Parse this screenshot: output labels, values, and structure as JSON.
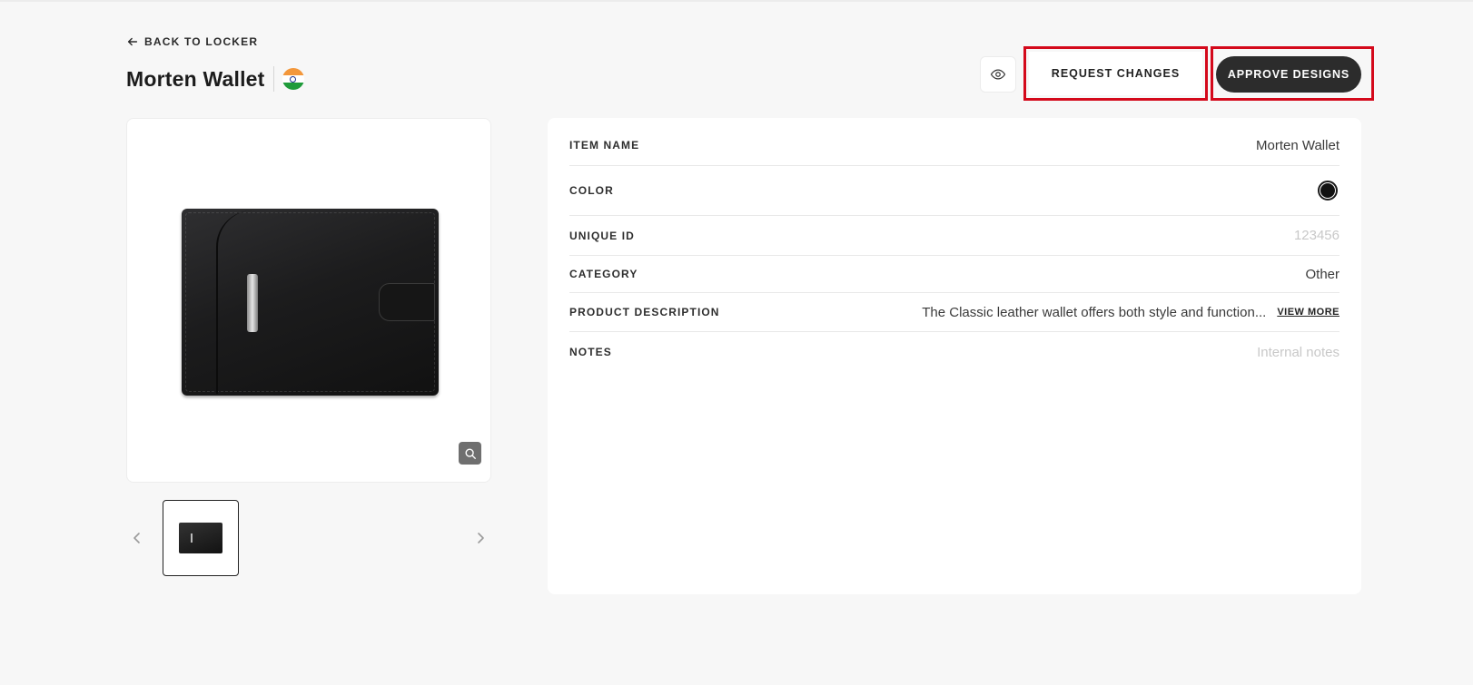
{
  "header": {
    "back_label": "BACK TO LOCKER",
    "title": "Morten Wallet",
    "flag_icon": "india-flag-icon",
    "preview_icon": "eye-icon",
    "request_changes_label": "REQUEST CHANGES",
    "approve_label": "APPROVE DESIGNS"
  },
  "colors": {
    "approve_bg": "#2c2c2c",
    "highlight": "#d4091b",
    "page_bg": "#f7f7f7"
  },
  "gallery": {
    "zoom_icon": "search-icon",
    "prev_icon": "chevron-left-icon",
    "next_icon": "chevron-right-icon",
    "thumbnail_count": 1
  },
  "details": {
    "item_name": {
      "label": "ITEM NAME",
      "value": "Morten Wallet"
    },
    "color": {
      "label": "COLOR",
      "swatch": "#111111"
    },
    "unique_id": {
      "label": "UNIQUE ID",
      "placeholder": "123456"
    },
    "category": {
      "label": "CATEGORY",
      "value": "Other"
    },
    "description": {
      "label": "PRODUCT DESCRIPTION",
      "value": "The Classic leather wallet offers both style and function...",
      "view_more": "VIEW MORE"
    },
    "notes": {
      "label": "NOTES",
      "placeholder": "Internal notes"
    }
  }
}
